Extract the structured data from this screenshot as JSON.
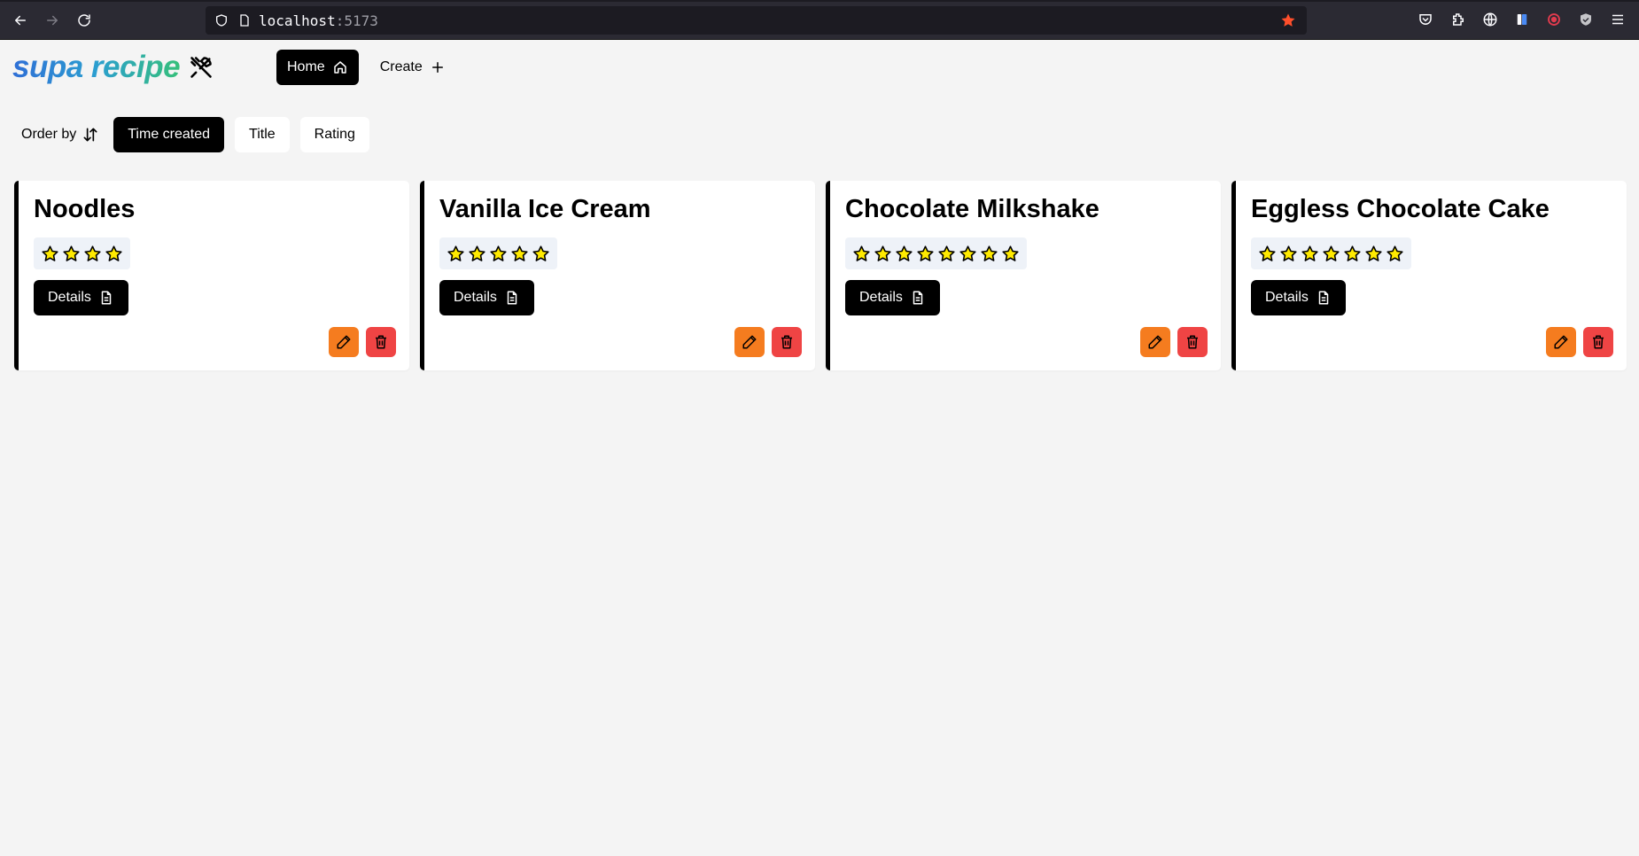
{
  "browser": {
    "url_host": "localhost",
    "url_port": ":5173"
  },
  "app": {
    "logo": "supa recipe",
    "nav": [
      {
        "label": "Home",
        "active": true
      },
      {
        "label": "Create",
        "active": false
      }
    ]
  },
  "order": {
    "label": "Order by",
    "options": [
      {
        "label": "Time created",
        "active": true
      },
      {
        "label": "Title",
        "active": false
      },
      {
        "label": "Rating",
        "active": false
      }
    ]
  },
  "recipes": [
    {
      "title": "Noodles",
      "rating": 4,
      "details_label": "Details"
    },
    {
      "title": "Vanilla Ice Cream",
      "rating": 5,
      "details_label": "Details"
    },
    {
      "title": "Chocolate Milkshake",
      "rating": 8,
      "details_label": "Details"
    },
    {
      "title": "Eggless Chocolate Cake",
      "rating": 7,
      "details_label": "Details"
    }
  ],
  "colors": {
    "edit": "#f57c1f",
    "delete": "#ef4444",
    "star_fill": "#ffea00",
    "bookmark_star": "#ff4f2b"
  }
}
